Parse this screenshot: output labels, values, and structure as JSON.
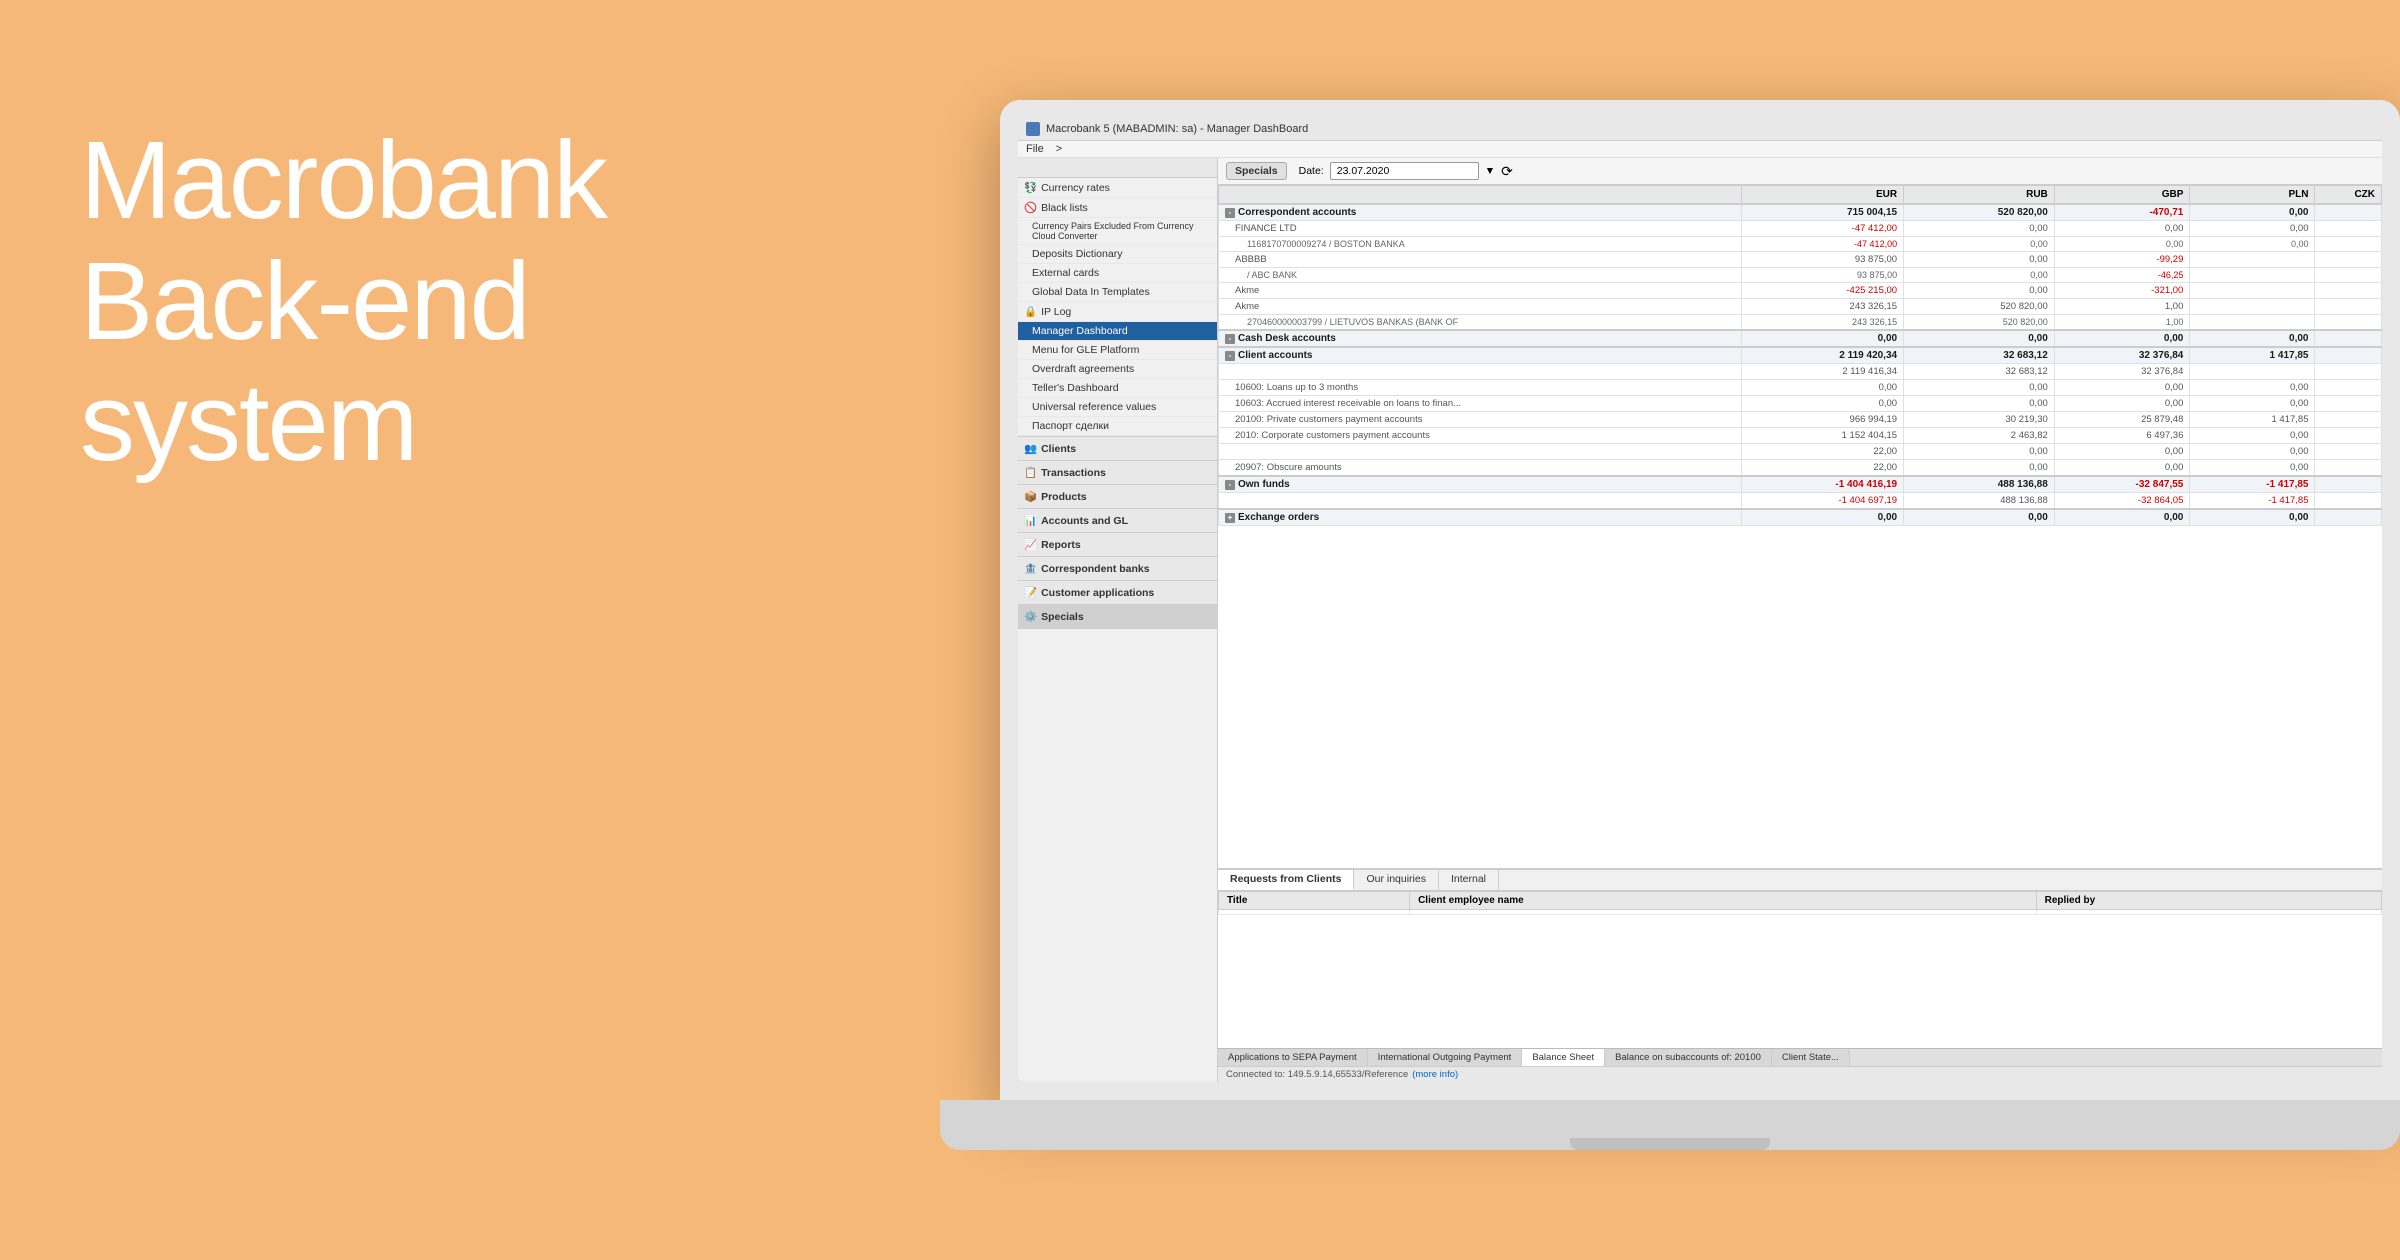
{
  "background_color": "#F5B878",
  "hero": {
    "line1": "Macrobank",
    "line2": "Back-end system"
  },
  "app": {
    "title_bar": "Macrobank 5 (MABADMIN: sa) - Manager DashBoard",
    "menu_items": [
      "File",
      ">"
    ],
    "toolbar": {
      "section_label": "Specials",
      "date_label": "Date:",
      "date_value": "23.07.2020",
      "refresh_icon": "⟳"
    },
    "sidebar": {
      "specials_section": [
        {
          "label": "Currency rates",
          "icon": "💱"
        },
        {
          "label": "Black lists",
          "icon": "🚫"
        },
        {
          "label": "Currency Pairs Excluded From Currency Cloud Converter",
          "icon": ""
        },
        {
          "label": "Deposits Dictionary",
          "icon": ""
        },
        {
          "label": "External cards",
          "icon": ""
        },
        {
          "label": "Global Data In Templates",
          "icon": ""
        },
        {
          "label": "IP Log",
          "icon": "🔒"
        },
        {
          "label": "Manager Dashboard",
          "icon": "",
          "active": true
        },
        {
          "label": "Menu for GLE Platform",
          "icon": ""
        },
        {
          "label": "Overdraft agreements",
          "icon": ""
        },
        {
          "label": "Teller's Dashboard",
          "icon": ""
        },
        {
          "label": "Universal reference values",
          "icon": ""
        },
        {
          "label": "Паспорт сделки",
          "icon": ""
        }
      ],
      "nav_groups": [
        {
          "label": "Clients",
          "icon": "👥"
        },
        {
          "label": "Transactions",
          "icon": "📋"
        },
        {
          "label": "Products",
          "icon": "📦"
        },
        {
          "label": "Accounts and GL",
          "icon": "📊"
        },
        {
          "label": "Reports",
          "icon": "📈"
        },
        {
          "label": "Correspondent banks",
          "icon": "🏦"
        },
        {
          "label": "Customer applications",
          "icon": "📝"
        },
        {
          "label": "Specials",
          "icon": "⚙️"
        }
      ]
    },
    "columns": [
      "",
      "EUR",
      "RUB",
      "GBP",
      "PLN",
      "CZK"
    ],
    "table_data": {
      "sections": [
        {
          "type": "section_header",
          "label": "Correspondent accounts",
          "values": [
            "715 004,15",
            "520 820,00",
            "-470,71",
            "0,00",
            ""
          ]
        },
        {
          "type": "sub",
          "label": "FINANCE LTD",
          "values": [
            "-47 412,00",
            "0,00",
            "0,00",
            "0,00",
            ""
          ]
        },
        {
          "type": "subsub",
          "label": "1168170700009274 / BOSTON BANKA",
          "values": [
            "-47 412,00",
            "0,00",
            "0,00",
            "0,00",
            ""
          ]
        },
        {
          "type": "sub",
          "label": "ABBBB",
          "values": [
            "93 875,00",
            "0,00",
            "-99,29",
            "",
            ""
          ]
        },
        {
          "type": "subsub",
          "label": "/ ABC BANK",
          "values": [
            "93 875,00",
            "0,00",
            "-46,25",
            "",
            ""
          ]
        },
        {
          "type": "sub",
          "label": "Akme",
          "values": [
            "-425 215,00",
            "0,00",
            "-321,00",
            "",
            ""
          ]
        },
        {
          "type": "sub",
          "label": "Akme",
          "values": [
            "243 326,15",
            "520 820,00",
            "1,00",
            "",
            ""
          ]
        },
        {
          "type": "subsub",
          "label": "270460000003799 / LIETUVOS BANKAS (BANK OF",
          "values": [
            "243 326,15",
            "520 820,00",
            "1,00",
            "",
            ""
          ]
        },
        {
          "type": "section_header",
          "label": "Cash Desk accounts",
          "values": [
            "0,00",
            "0,00",
            "0,00",
            "0,00",
            ""
          ]
        },
        {
          "type": "section_header",
          "label": "Client accounts",
          "values": [
            "2 119 420,34",
            "32 683,12",
            "32 376,84",
            "1 417,85",
            ""
          ]
        },
        {
          "type": "sub",
          "label": "",
          "values": [
            "2 119 416,34",
            "32 683,12",
            "32 376,84",
            "",
            ""
          ]
        },
        {
          "type": "sub",
          "label": "10600: Loans up to 3 months",
          "values": [
            "0,00",
            "0,00",
            "0,00",
            "0,00",
            ""
          ]
        },
        {
          "type": "sub",
          "label": "10603: Accrued interest receivable on loans to finan...",
          "values": [
            "0,00",
            "0,00",
            "0,00",
            "0,00",
            ""
          ]
        },
        {
          "type": "sub",
          "label": "20100: Private customers payment accounts",
          "values": [
            "966 994,19",
            "30 219,30",
            "25 879,48",
            "1 417,85",
            ""
          ]
        },
        {
          "type": "sub",
          "label": "2010: Corporate customers payment accounts",
          "values": [
            "1 152 404,15",
            "2 463,82",
            "6 497,36",
            "0,00",
            ""
          ]
        },
        {
          "type": "sub",
          "label": "",
          "values": [
            "22,00",
            "0,00",
            "0,00",
            "0,00",
            ""
          ]
        },
        {
          "type": "sub",
          "label": "20907: Obscure amounts",
          "values": [
            "22,00",
            "0,00",
            "0,00",
            "0,00",
            ""
          ]
        },
        {
          "type": "section_header",
          "label": "Own funds",
          "values": [
            "-1 404 416,19",
            "488 136,88",
            "-32 847,55",
            "-1 417,85",
            ""
          ]
        },
        {
          "type": "sub",
          "label": "",
          "values": [
            "-1 404 697,19",
            "488 136,88",
            "-32 864,05",
            "-1 417,85",
            ""
          ]
        },
        {
          "type": "section_header",
          "label": "Exchange orders",
          "values": [
            "0,00",
            "0,00",
            "0,00",
            "0,00",
            ""
          ]
        }
      ]
    },
    "bottom_panel": {
      "tabs": [
        "Requests from Clients",
        "Our inquiries",
        "Internal"
      ],
      "active_tab": "Requests from Clients",
      "columns": [
        "Title",
        "Client employee name",
        "Replied by"
      ]
    },
    "bottom_strip": {
      "tabs": [
        {
          "label": "Applications to SEPA Payment",
          "active": false
        },
        {
          "label": "International Outgoing Payment",
          "active": false
        },
        {
          "label": "Balance Sheet",
          "active": true
        },
        {
          "label": "Balance on subaccounts of: 20100",
          "active": false
        },
        {
          "label": "Client State...",
          "active": false
        }
      ]
    },
    "status_bar": {
      "text": "Connected to: 149.5.9.14,65533/Reference",
      "more_info": "(more info)"
    }
  }
}
